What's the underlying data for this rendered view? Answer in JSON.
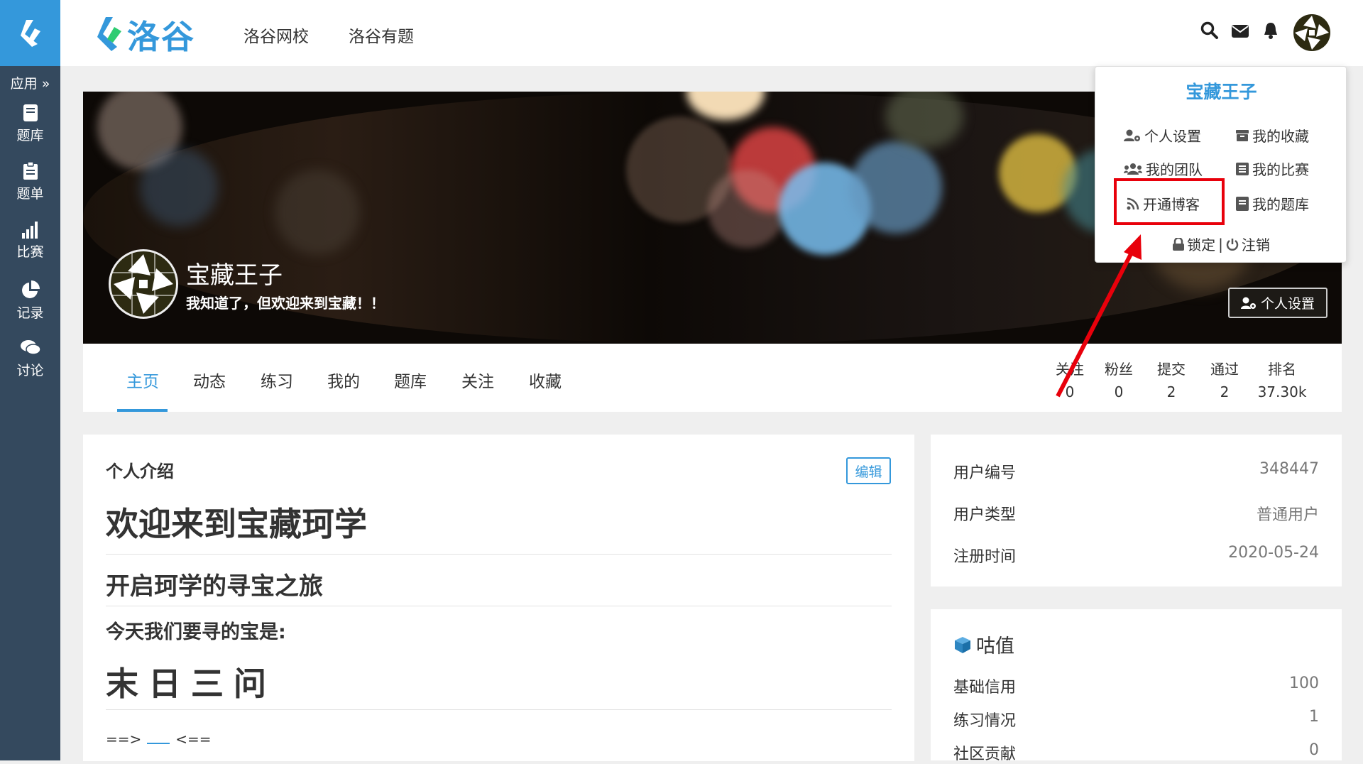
{
  "brand": {
    "name": "洛谷"
  },
  "sidebar": {
    "apps_label": "应用 »",
    "items": [
      {
        "label": "题库",
        "icon": "book-icon"
      },
      {
        "label": "题单",
        "icon": "clipboard-icon"
      },
      {
        "label": "比赛",
        "icon": "bar-chart-icon"
      },
      {
        "label": "记录",
        "icon": "pie-chart-icon"
      },
      {
        "label": "讨论",
        "icon": "comments-icon"
      }
    ]
  },
  "topnav": {
    "items": [
      "洛谷网校",
      "洛谷有题"
    ]
  },
  "profile": {
    "name": "宝藏王子",
    "bio": "我知道了，但欢迎来到宝藏！！",
    "settings_button": "个人设置"
  },
  "tabs": [
    "主页",
    "动态",
    "练习",
    "我的",
    "题库",
    "关注",
    "收藏"
  ],
  "stats": [
    {
      "label": "关注",
      "value": "0"
    },
    {
      "label": "粉丝",
      "value": "0"
    },
    {
      "label": "提交",
      "value": "2"
    },
    {
      "label": "通过",
      "value": "2"
    },
    {
      "label": "排名",
      "value": "37.30k"
    }
  ],
  "intro": {
    "title": "个人介绍",
    "edit_button": "编辑",
    "h1": "欢迎来到宝藏珂学",
    "h2": "开启珂学的寻宝之旅",
    "h3": "今天我们要寻的宝是:",
    "h1b": "末日三问",
    "marker_left": "==>",
    "marker_right": "<=="
  },
  "info": {
    "rows": [
      {
        "label": "用户编号",
        "value": "348447"
      },
      {
        "label": "用户类型",
        "value": "普通用户"
      },
      {
        "label": "注册时间",
        "value": "2020-05-24"
      }
    ]
  },
  "gu": {
    "title": "咕值",
    "rows": [
      {
        "label": "基础信用",
        "value": "100"
      },
      {
        "label": "练习情况",
        "value": "1"
      },
      {
        "label": "社区贡献",
        "value": "0"
      }
    ]
  },
  "dropdown": {
    "name": "宝藏王子",
    "items": [
      "个人设置",
      "我的收藏",
      "我的团队",
      "我的比赛",
      "开通博客",
      "我的题库"
    ],
    "lock": "锁定",
    "sep": "|",
    "logout": "注销"
  },
  "colors": {
    "accent": "#3498db",
    "sidebar": "#34495e",
    "highlight": "#e8000b"
  }
}
